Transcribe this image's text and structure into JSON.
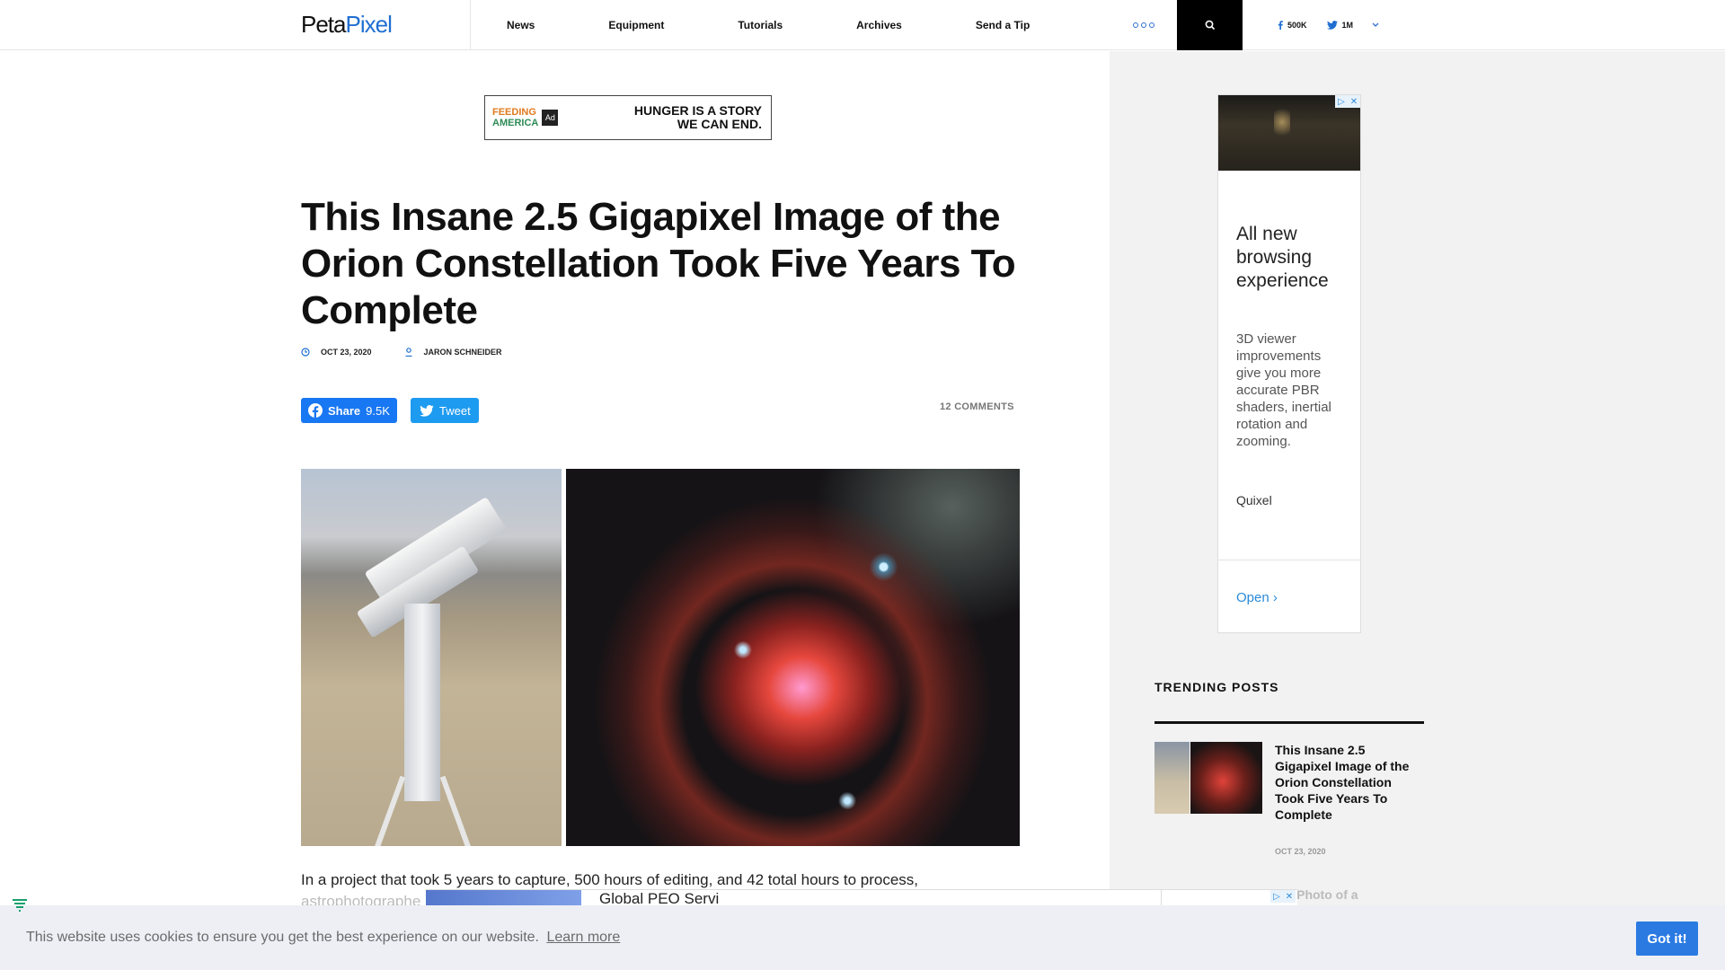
{
  "header": {
    "logo_part1": "Peta",
    "logo_part2": "Pixel",
    "nav": [
      "News",
      "Equipment",
      "Tutorials",
      "Archives",
      "Send a Tip"
    ],
    "facebook_count": "500K",
    "twitter_count": "1M"
  },
  "top_ad": {
    "brand_line1": "FEEDING",
    "brand_line2": "AMERICA",
    "ad_label": "Ad",
    "text_line1": "HUNGER IS A STORY",
    "text_line2": "WE CAN END."
  },
  "article": {
    "title": "This Insane 2.5 Gigapixel Image of the Orion Constellation Took Five Years To Complete",
    "date": "OCT 23, 2020",
    "author": "JARON SCHNEIDER",
    "share_label": "Share",
    "share_count": "9.5K",
    "tweet_label": "Tweet",
    "comments": "12 COMMENTS",
    "lede": "In a project that took 5 years to capture, 500 hours of editing, and 42 total hours to process,",
    "lede_cut": "astrophotographe"
  },
  "sidebar_ad": {
    "headline": "All new browsing experience",
    "body": "3D viewer improvements give you more accurate PBR shaders, inertial rotation and zooming.",
    "brand": "Quixel",
    "cta": "Open"
  },
  "trending": {
    "heading": "TRENDING POSTS",
    "items": [
      {
        "title": "This Insane 2.5 Gigapixel Image of the Orion Constellation Took Five Years To Complete",
        "date": "OCT 23, 2020"
      }
    ],
    "next_title_partial": "gic Photo of a"
  },
  "bottom_ad": {
    "text": "Global PEO Servi"
  },
  "cookie": {
    "message": "This website uses cookies to ensure you get the best experience on our website.",
    "learn_more": "Learn more",
    "button": "Got it!"
  },
  "colors": {
    "brand_blue": "#1f6fd1",
    "facebook": "#1877f2",
    "twitter": "#1d9bf0",
    "cookie_button": "#2a7ae2"
  }
}
